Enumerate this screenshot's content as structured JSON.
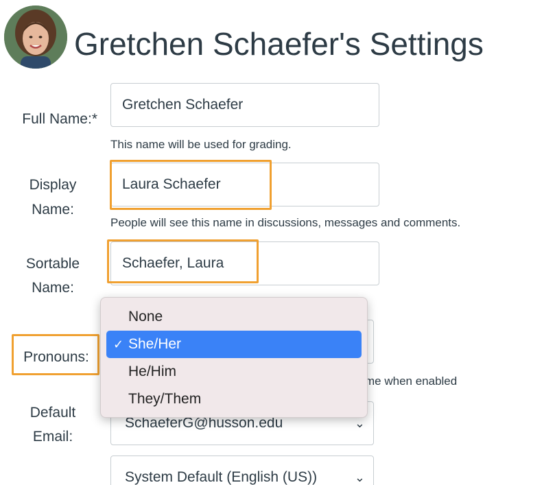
{
  "header": {
    "title": "Gretchen Schaefer's Settings"
  },
  "form": {
    "full_name": {
      "label": "Full Name:*",
      "value": "Gretchen Schaefer",
      "helper": "This name will be used for grading."
    },
    "display_name": {
      "label_line1": "Display",
      "label_line2": "Name:",
      "value": "Laura Schaefer",
      "helper": "People will see this name in discussions, messages and comments."
    },
    "sortable_name": {
      "label_line1": "Sortable",
      "label_line2": "Name:",
      "value": "Schaefer, Laura"
    },
    "pronouns": {
      "label": "Pronouns:",
      "helper_partial": "me when enabled",
      "selected": "She/Her",
      "options": [
        "None",
        "She/Her",
        "He/Him",
        "They/Them"
      ],
      "check_icon": "✓"
    },
    "default_email": {
      "label_line1": "Default",
      "label_line2": "Email:",
      "value": "SchaeferG@husson.edu",
      "chevron": "⌄"
    },
    "language": {
      "value": "System Default (English (US))",
      "chevron": "⌄"
    }
  },
  "colors": {
    "highlight": "#f0a030",
    "selected_option": "#3a82f7",
    "menu_bg": "#f1e8ea"
  }
}
